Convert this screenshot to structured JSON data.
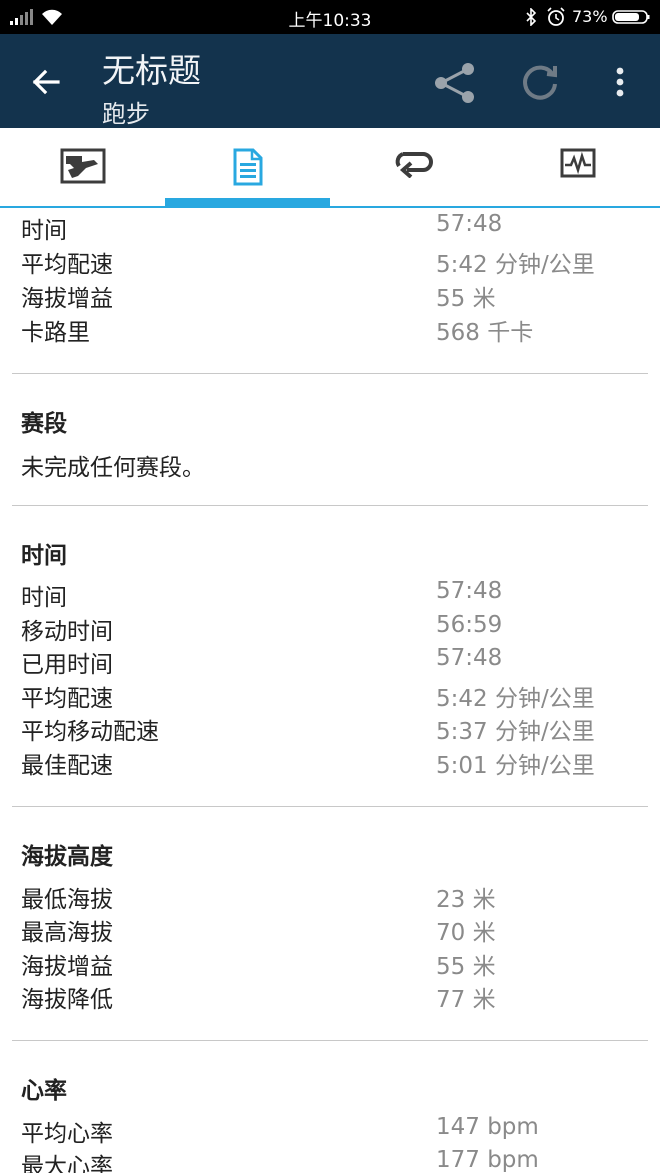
{
  "status_bar": {
    "time": "上午10:33",
    "battery": "73%"
  },
  "app_bar": {
    "title": "无标题",
    "subtitle": "跑步"
  },
  "tabs": [
    {
      "icon": "map-icon"
    },
    {
      "icon": "details-document-icon",
      "selected": true
    },
    {
      "icon": "laps-repeat-icon"
    },
    {
      "icon": "chart-icon"
    }
  ],
  "summary": [
    {
      "label": "时间",
      "value": "57:48"
    },
    {
      "label": "平均配速",
      "value": "5:42 分钟/公里"
    },
    {
      "label": "海拔增益",
      "value": "55 米"
    },
    {
      "label": "卡路里",
      "value": "568 千卡"
    }
  ],
  "segments": {
    "heading": "赛段",
    "message": "未完成任何赛段。"
  },
  "timing": {
    "heading": "时间",
    "rows": [
      {
        "label": "时间",
        "value": "57:48"
      },
      {
        "label": "移动时间",
        "value": "56:59"
      },
      {
        "label": "已用时间",
        "value": "57:48"
      },
      {
        "label": "平均配速",
        "value": "5:42 分钟/公里"
      },
      {
        "label": "平均移动配速",
        "value": "5:37 分钟/公里"
      },
      {
        "label": "最佳配速",
        "value": "5:01 分钟/公里"
      }
    ]
  },
  "elevation": {
    "heading": "海拔高度",
    "rows": [
      {
        "label": "最低海拔",
        "value": "23 米"
      },
      {
        "label": "最高海拔",
        "value": "70 米"
      },
      {
        "label": "海拔增益",
        "value": "55 米"
      },
      {
        "label": "海拔降低",
        "value": "77 米"
      }
    ]
  },
  "heart_rate": {
    "heading": "心率",
    "rows": [
      {
        "label": "平均心率",
        "value": "147 bpm"
      },
      {
        "label": "最大心率",
        "value": "177 bpm"
      }
    ]
  },
  "colors": {
    "app_bar": "#13334d",
    "accent": "#29a8e0",
    "value_text": "#8a8a8a"
  }
}
